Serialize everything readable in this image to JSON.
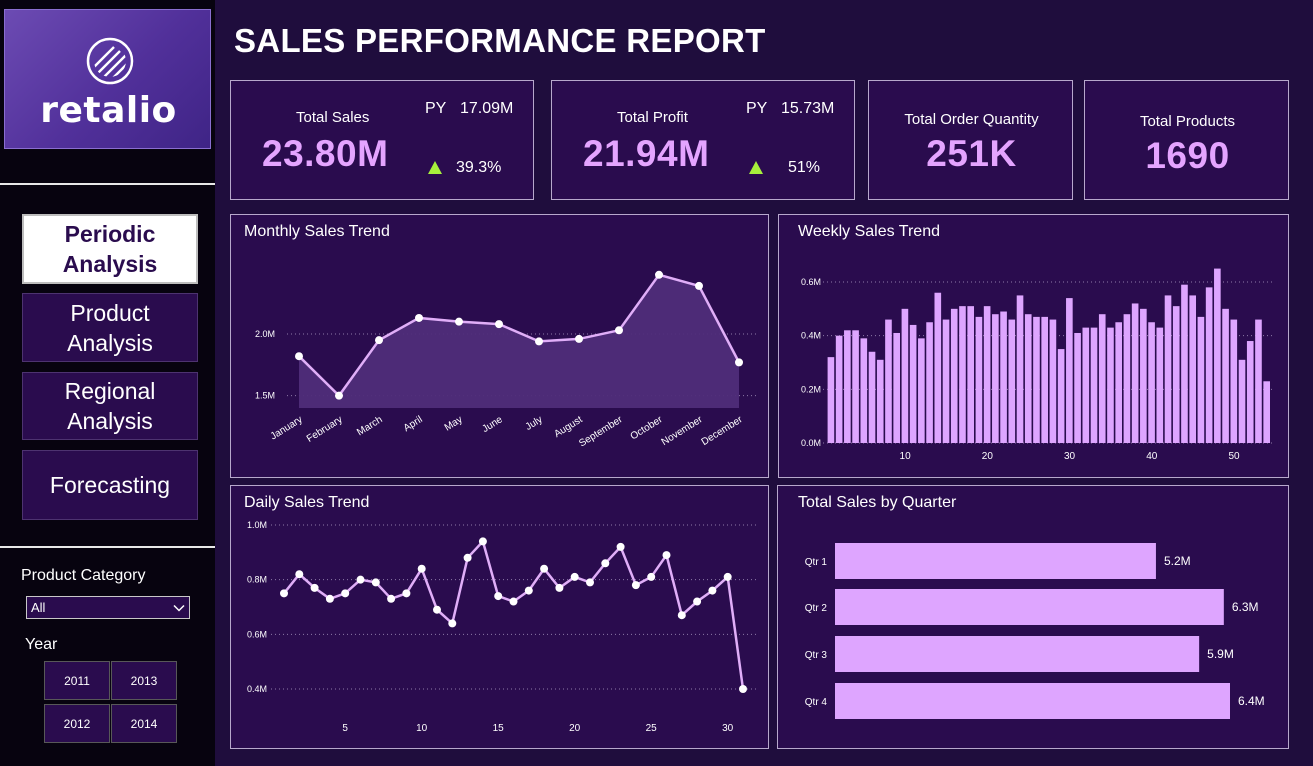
{
  "brand": {
    "name": "retalio"
  },
  "page_title": "SALES PERFORMANCE REPORT",
  "nav": [
    {
      "label": "Periodic\nAnalysis",
      "active": true
    },
    {
      "label": "Product\nAnalysis",
      "active": false
    },
    {
      "label": "Regional\nAnalysis",
      "active": false
    },
    {
      "label": "Forecasting",
      "active": false
    }
  ],
  "filters": {
    "category_label": "Product Category",
    "category_value": "All",
    "year_label": "Year",
    "years": [
      "2011",
      "2013",
      "2012",
      "2014"
    ]
  },
  "kpis": {
    "sales": {
      "label": "Total Sales",
      "value": "23.80M",
      "py_label": "PY",
      "py_value": "17.09M",
      "change": "39.3%"
    },
    "profit": {
      "label": "Total Profit",
      "value": "21.94M",
      "py_label": "PY",
      "py_value": "15.73M",
      "change": "51%"
    },
    "orders": {
      "label": "Total Order Quantity",
      "value": "251K"
    },
    "products": {
      "label": "Total Products",
      "value": "1690"
    }
  },
  "colors": {
    "background": "#1f0d3d",
    "panel": "#2a0c4e",
    "accent": "#e4a4ff",
    "bar": "#dea5ff",
    "line": "#e0aef8",
    "up_arrow": "#a7f03c"
  },
  "chart_data": [
    {
      "type": "area",
      "title": "Monthly Sales Trend",
      "categories": [
        "January",
        "February",
        "March",
        "April",
        "May",
        "June",
        "July",
        "August",
        "September",
        "October",
        "November",
        "December"
      ],
      "values": [
        1.82,
        1.5,
        1.95,
        2.13,
        2.1,
        2.08,
        1.94,
        1.96,
        2.03,
        2.48,
        2.39,
        1.77
      ],
      "y_ticks": [
        "1.5M",
        "2.0M"
      ],
      "ylim": [
        1.4,
        2.6
      ],
      "grid": true
    },
    {
      "type": "bar",
      "title": "Weekly Sales Trend",
      "x": [
        1,
        2,
        3,
        4,
        5,
        6,
        7,
        8,
        9,
        10,
        11,
        12,
        13,
        14,
        15,
        16,
        17,
        18,
        19,
        20,
        21,
        22,
        23,
        24,
        25,
        26,
        27,
        28,
        29,
        30,
        31,
        32,
        33,
        34,
        35,
        36,
        37,
        38,
        39,
        40,
        41,
        42,
        43,
        44,
        45,
        46,
        47,
        48,
        49,
        50,
        51,
        52,
        53
      ],
      "values": [
        0.32,
        0.4,
        0.42,
        0.42,
        0.39,
        0.34,
        0.31,
        0.46,
        0.41,
        0.5,
        0.44,
        0.39,
        0.45,
        0.56,
        0.46,
        0.5,
        0.51,
        0.51,
        0.47,
        0.51,
        0.48,
        0.49,
        0.46,
        0.55,
        0.48,
        0.47,
        0.47,
        0.46,
        0.35,
        0.54,
        0.41,
        0.43,
        0.43,
        0.48,
        0.43,
        0.45,
        0.48,
        0.52,
        0.5,
        0.45,
        0.43,
        0.55,
        0.51,
        0.59,
        0.55,
        0.47,
        0.58,
        0.65,
        0.5,
        0.46,
        0.31,
        0.38,
        0.46,
        0.23
      ],
      "x_ticks": [
        "10",
        "20",
        "30",
        "40",
        "50"
      ],
      "y_ticks": [
        "0.0M",
        "0.2M",
        "0.4M",
        "0.6M"
      ],
      "ylim": [
        0,
        0.6
      ],
      "grid": true
    },
    {
      "type": "line",
      "title": "Daily Sales Trend",
      "x": [
        1,
        2,
        3,
        4,
        5,
        6,
        7,
        8,
        9,
        10,
        11,
        12,
        13,
        14,
        15,
        16,
        17,
        18,
        19,
        20,
        21,
        22,
        23,
        24,
        25,
        26,
        27,
        28,
        29,
        30,
        31
      ],
      "values": [
        0.75,
        0.82,
        0.77,
        0.73,
        0.75,
        0.8,
        0.79,
        0.73,
        0.75,
        0.84,
        0.69,
        0.64,
        0.88,
        0.94,
        0.74,
        0.72,
        0.76,
        0.84,
        0.77,
        0.81,
        0.79,
        0.86,
        0.92,
        0.78,
        0.81,
        0.89,
        0.67,
        0.72,
        0.76,
        0.81,
        0.4
      ],
      "x_ticks": [
        "5",
        "10",
        "15",
        "20",
        "25",
        "30"
      ],
      "y_ticks": [
        "0.4M",
        "0.6M",
        "0.8M",
        "1.0M"
      ],
      "ylim": [
        0.4,
        1.0
      ],
      "grid": true
    },
    {
      "type": "bar",
      "orientation": "horizontal",
      "title": "Total Sales by Quarter",
      "categories": [
        "Qtr 1",
        "Qtr 2",
        "Qtr 3",
        "Qtr 4"
      ],
      "values": [
        5.2,
        6.3,
        5.9,
        6.4
      ],
      "labels": [
        "5.2M",
        "6.3M",
        "5.9M",
        "6.4M"
      ]
    }
  ]
}
